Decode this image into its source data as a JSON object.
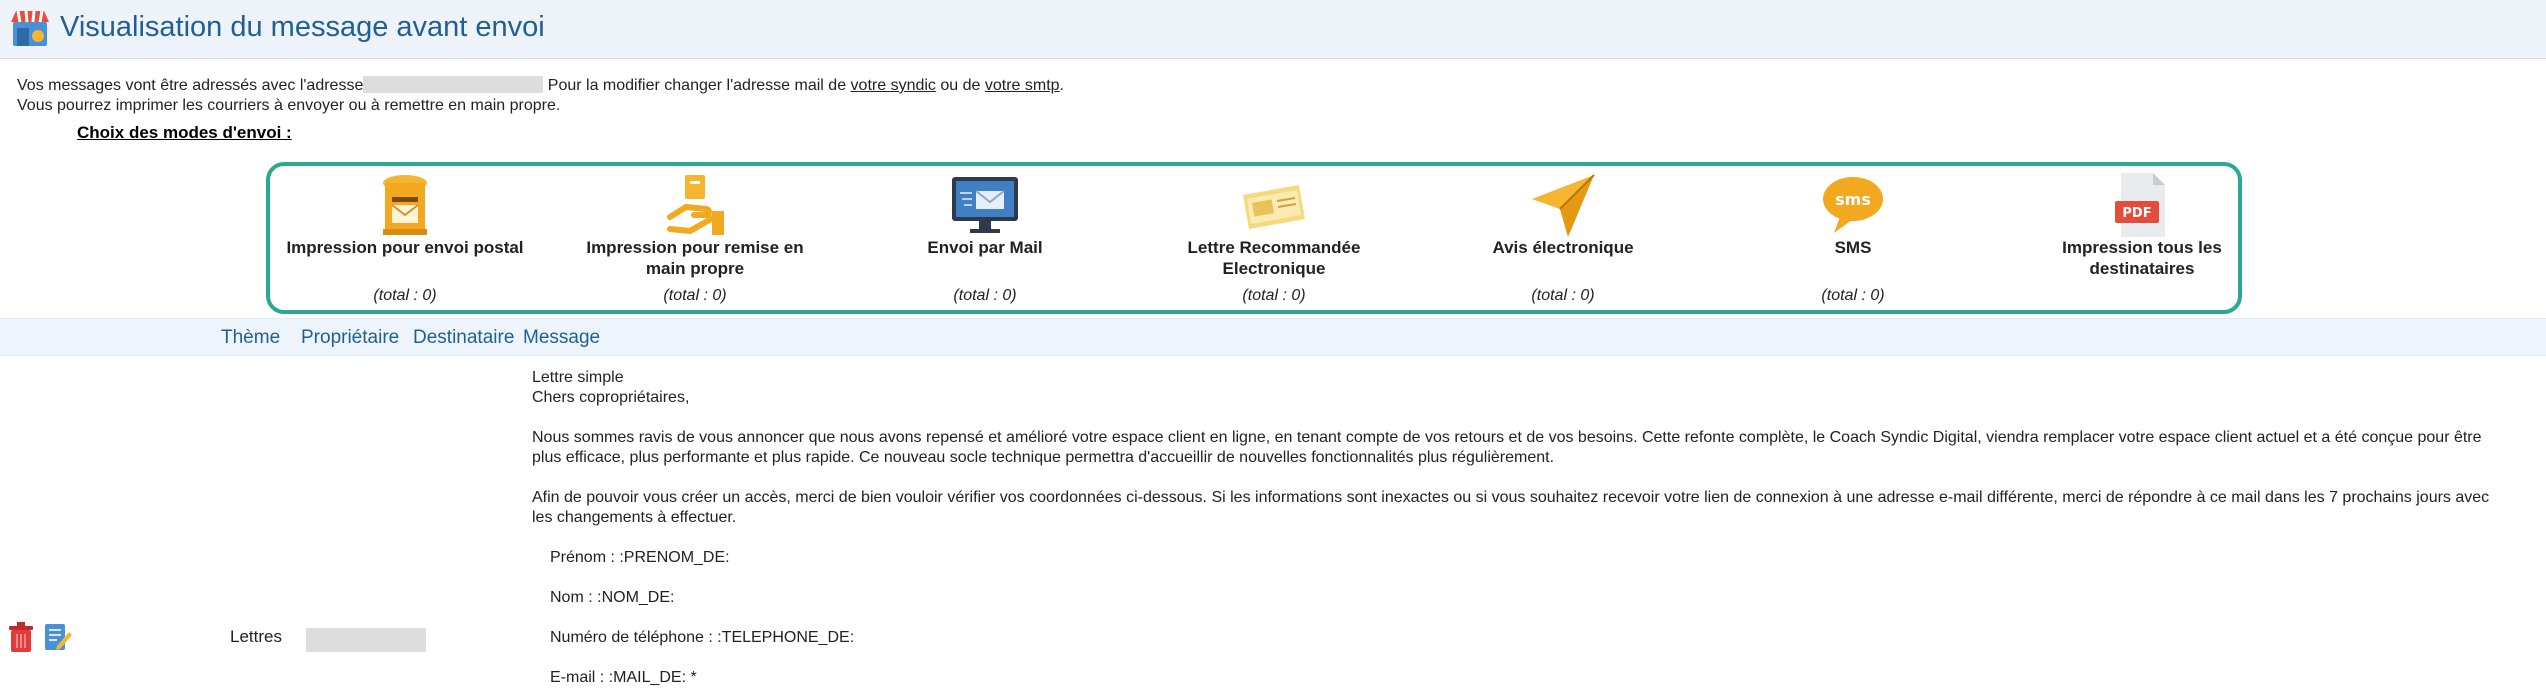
{
  "header": {
    "title": "Visualisation du message avant envoi",
    "icon": "shop-icon"
  },
  "intro": {
    "line1_before": "Vos messages vont être adressés avec l'adresse",
    "line1_after": " Pour la modifier changer l'adresse mail de ",
    "syndic_link": "votre syndic",
    "or_text": " ou de ",
    "smtp_link": "votre smtp",
    "period": ".",
    "line2": "Vous pourrez imprimer les courriers à envoyer ou à remettre en main propre."
  },
  "modes": {
    "title": "Choix des modes d'envoi :",
    "accent_color": "#2aa992",
    "items": [
      {
        "label": "Impression pour envoi postal",
        "total": "(total : 0)",
        "icon": "mailbox-icon"
      },
      {
        "label": "Impression pour remise en main propre",
        "total": "(total : 0)",
        "icon": "hand-delivery-icon"
      },
      {
        "label": "Envoi par Mail",
        "total": "(total : 0)",
        "icon": "monitor-mail-icon"
      },
      {
        "label": "Lettre Recommandée Electronique",
        "total": "(total : 0)",
        "icon": "registered-letter-icon"
      },
      {
        "label": "Avis électronique",
        "total": "(total : 0)",
        "icon": "paper-plane-icon"
      },
      {
        "label": "SMS",
        "total": "(total : 0)",
        "icon": "sms-icon"
      },
      {
        "label": "Impression tous les destinataires",
        "total": "",
        "icon": "pdf-icon"
      }
    ]
  },
  "table": {
    "headers": [
      "Thème",
      "Propriétaire",
      "Destinataire",
      "Message"
    ],
    "row": {
      "theme": "Lettres",
      "actions": [
        "trash-icon",
        "edit-icon"
      ],
      "message": {
        "subject": "Lettre simple",
        "greeting": "Chers copropriétaires,",
        "para1": "Nous sommes ravis de vous annoncer que nous avons repensé et amélioré votre espace client en ligne, en tenant compte de vos retours et de vos besoins. Cette refonte complète, le Coach Syndic Digital, viendra remplacer votre espace client actuel et a été conçue pour être plus efficace, plus performante et plus rapide. Ce nouveau socle technique permettra d'accueillir de nouvelles fonctionnalités plus régulièrement.",
        "para2": "Afin de pouvoir vous créer un accès, merci de bien vouloir vérifier vos coordonnées ci-dessous. Si les informations sont inexactes ou si vous souhaitez recevoir votre lien de connexion à une adresse e-mail différente, merci de répondre à ce mail dans les 7 prochains jours avec les changements à effectuer.",
        "field_prenom": "Prénom : :PRENOM_DE:",
        "field_nom": "Nom : :NOM_DE:",
        "field_tel": "Numéro de téléphone : :TELEPHONE_DE:",
        "field_mail": "E-mail : :MAIL_DE: *"
      }
    }
  }
}
